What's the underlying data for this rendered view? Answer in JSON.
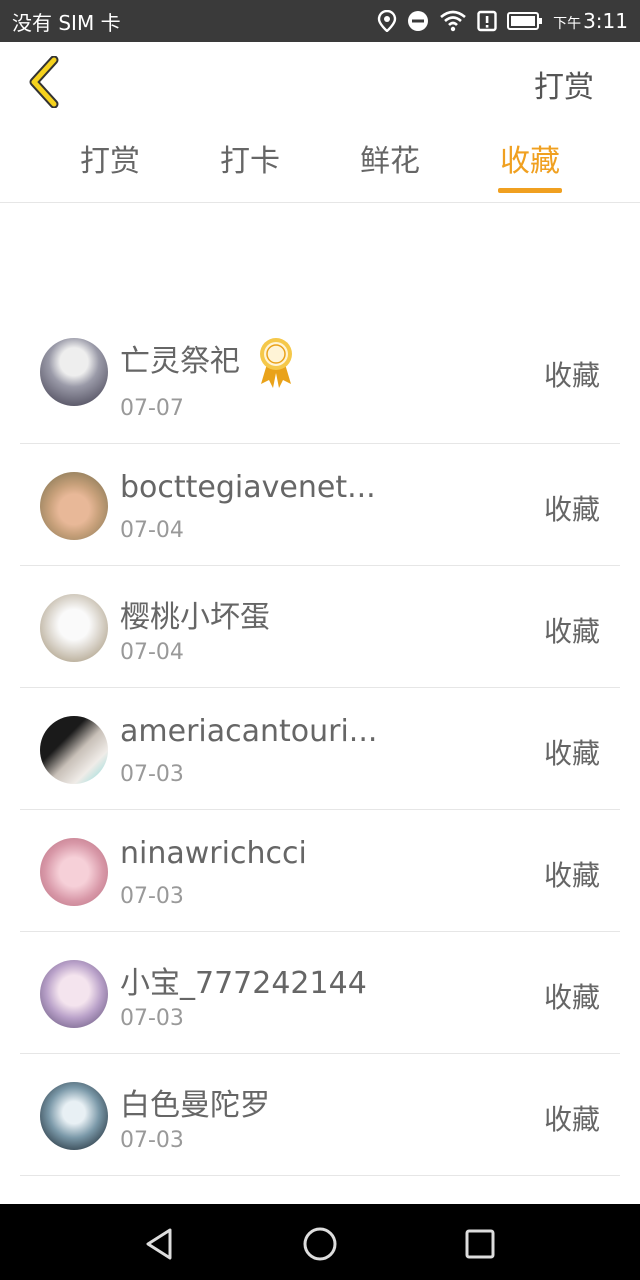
{
  "status_bar": {
    "carrier": "没有 SIM 卡",
    "time_prefix": "下午",
    "time": "3:11",
    "icons": [
      "location-icon",
      "do-not-disturb-icon",
      "wifi-icon",
      "alert-icon",
      "battery-icon"
    ]
  },
  "header": {
    "back_icon": "chevron-left-icon",
    "right_label": "打赏"
  },
  "tabs": [
    {
      "label": "打赏"
    },
    {
      "label": "打卡"
    },
    {
      "label": "鲜花"
    },
    {
      "label": "收藏"
    }
  ],
  "active_tab": "收藏",
  "list": [
    {
      "name": "亡灵祭祀",
      "date": "07-07",
      "action": "收藏",
      "badge": "award-ribbon-icon"
    },
    {
      "name": "bocttegiavenet...",
      "date": "07-04",
      "action": "收藏"
    },
    {
      "name": "樱桃小坏蛋",
      "date": "07-04",
      "action": "收藏"
    },
    {
      "name": "ameriacantouri...",
      "date": "07-03",
      "action": "收藏"
    },
    {
      "name": "ninawrichcci",
      "date": "07-03",
      "action": "收藏"
    },
    {
      "name": "小宝_777242144",
      "date": "07-03",
      "action": "收藏"
    },
    {
      "name": "白色曼陀罗",
      "date": "07-03",
      "action": "收藏"
    }
  ],
  "nav_bar": {
    "icons": [
      "back-triangle-icon",
      "home-circle-icon",
      "recents-square-icon"
    ]
  },
  "colors": {
    "accent": "#f0a020",
    "status_bar": "#3a3a3a",
    "back_icon": "#f5d21e"
  }
}
